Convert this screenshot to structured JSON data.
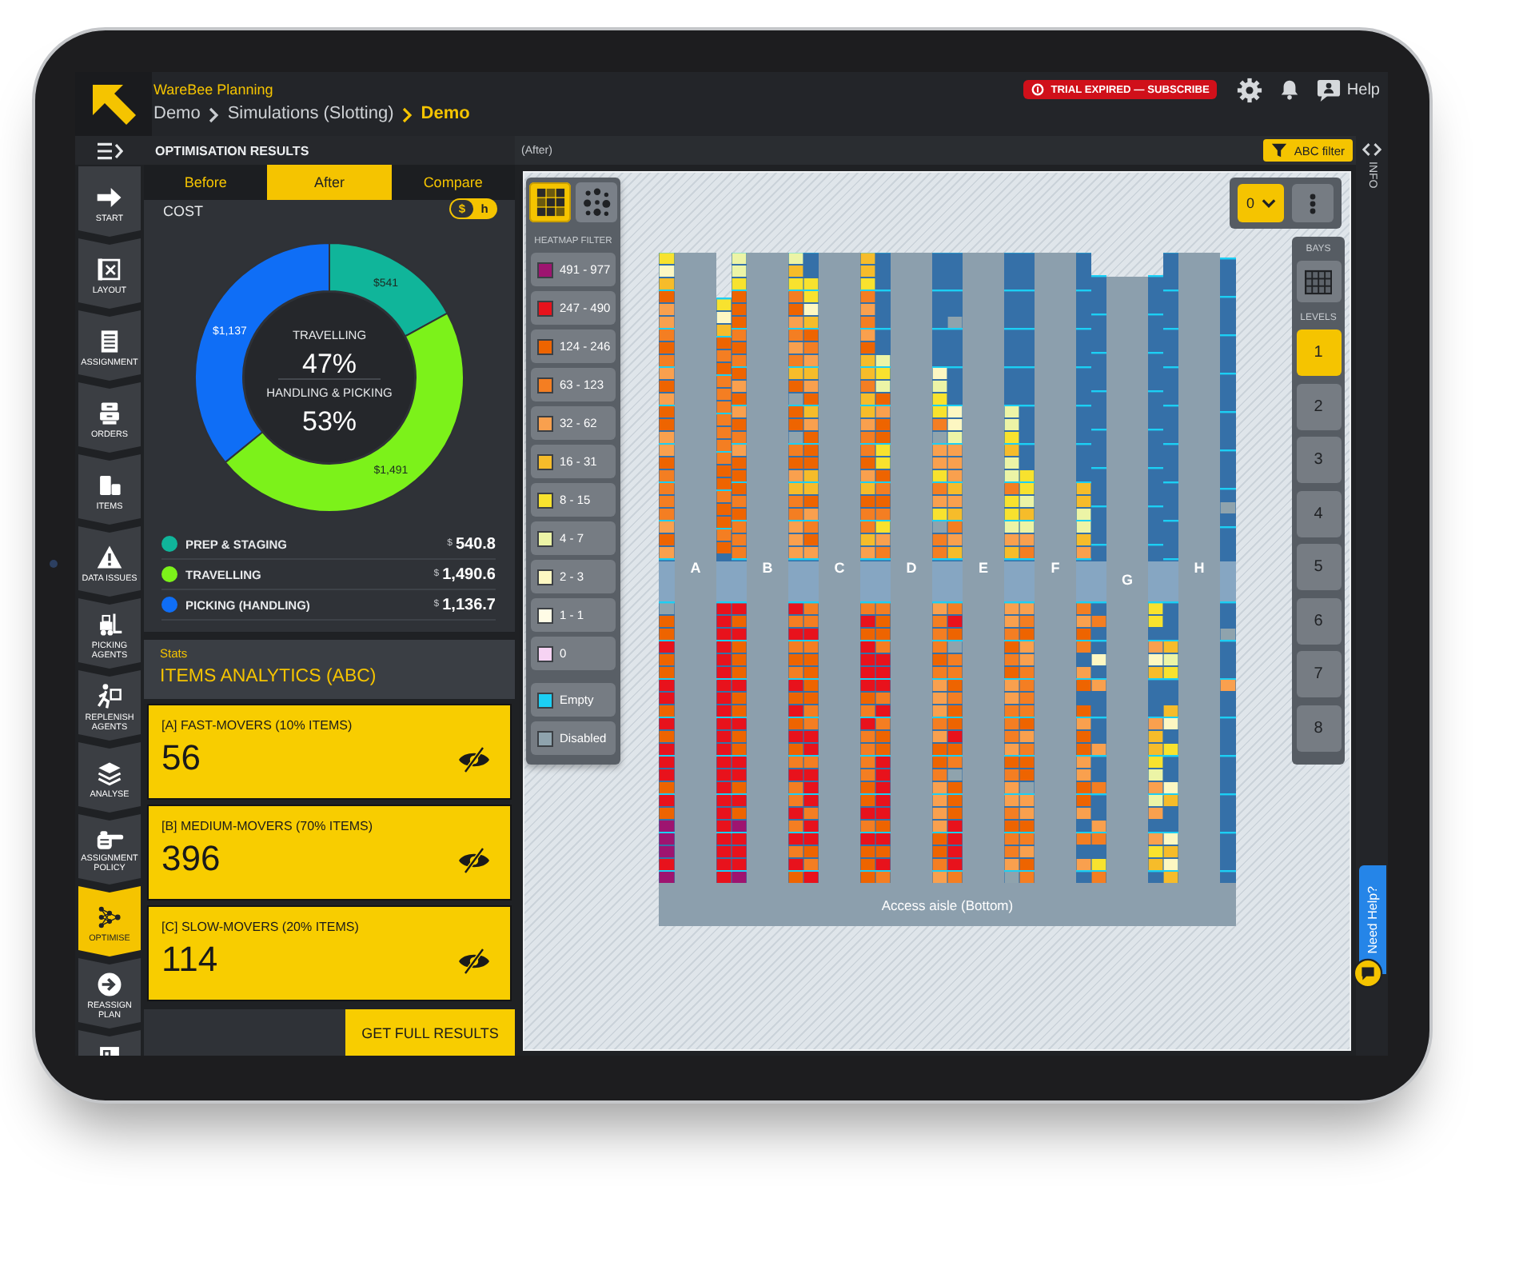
{
  "header": {
    "app_name": "WareBee Planning",
    "breadcrumb": [
      {
        "label": "Demo",
        "current": false
      },
      {
        "label": "Simulations (Slotting)",
        "current": false
      },
      {
        "label": "Demo",
        "current": true
      }
    ],
    "trial_badge": "TRIAL EXPIRED — SUBSCRIBE",
    "help": "Help"
  },
  "sidebar": {
    "items": [
      {
        "label": "START",
        "selected": false
      },
      {
        "label": "LAYOUT",
        "selected": false
      },
      {
        "label": "ASSIGNMENT",
        "selected": false
      },
      {
        "label": "ORDERS",
        "selected": false
      },
      {
        "label": "ITEMS",
        "selected": false
      },
      {
        "label": "DATA ISSUES",
        "selected": false
      },
      {
        "label": "PICKING AGENTS",
        "selected": false
      },
      {
        "label": "REPLENISH AGENTS",
        "selected": false
      },
      {
        "label": "ANALYSE",
        "selected": false
      },
      {
        "label": "ASSIGNMENT POLICY",
        "selected": false
      },
      {
        "label": "OPTIMISE",
        "selected": true
      },
      {
        "label": "REASSIGN PLAN",
        "selected": false
      },
      {
        "selected": false
      }
    ]
  },
  "results_panel": {
    "title": "OPTIMISATION RESULTS",
    "tabs": [
      {
        "label": "Before",
        "selected": false
      },
      {
        "label": "After",
        "selected": true
      },
      {
        "label": "Compare",
        "selected": false
      }
    ],
    "cost": {
      "title": "COST",
      "unit_toggle": [
        {
          "label": "$",
          "selected": true
        },
        {
          "label": "h",
          "selected": false
        }
      ],
      "chart_data": {
        "type": "donut",
        "categories": [
          "PREP & STAGING",
          "TRAVELLING",
          "PICKING (HANDLING)"
        ],
        "values": [
          540.8,
          1490.6,
          1136.7
        ],
        "value_labels": [
          "$541",
          "$1,491",
          "$1,137"
        ]
      },
      "center": [
        {
          "label": "TRAVELLING",
          "value": "47%"
        },
        {
          "label": "HANDLING & PICKING",
          "value": "53%"
        }
      ],
      "legend": [
        {
          "currency": "$",
          "amount": "540.8",
          "color": "#10b59a"
        },
        {
          "currency": "$",
          "amount": "1,490.6",
          "color": "#7cf21a"
        },
        {
          "currency": "$",
          "amount": "1,136.7",
          "color": "#0f6ef6"
        }
      ]
    }
  },
  "stats": {
    "kicker": "Stats",
    "title": "ITEMS ANALYTICS (ABC)",
    "cards": [
      {
        "label": "[A] FAST-MOVERS (10% ITEMS)",
        "value": "56"
      },
      {
        "label": "[B] MEDIUM-MOVERS (70% ITEMS)",
        "value": "396"
      },
      {
        "label": "[C] SLOW-MOVERS (20% ITEMS)",
        "value": "114"
      }
    ],
    "action": "GET FULL RESULTS"
  },
  "map_view": {
    "title": "(After)",
    "abc_filter": "ABC filter",
    "view_modes": [
      {
        "selected": true
      },
      {
        "selected": false
      }
    ],
    "heatmap_filter": {
      "title": "HEATMAP FILTER",
      "items": [
        {
          "label": "491 - 977",
          "color": "#9e1470"
        },
        {
          "label": "247 - 490",
          "color": "#e8121c"
        },
        {
          "label": "124 - 246",
          "color": "#ee6400"
        },
        {
          "label": "63 - 123",
          "color": "#f47e22"
        },
        {
          "label": "32 - 62",
          "color": "#f9a04e"
        },
        {
          "label": "16 - 31",
          "color": "#f6bc2a"
        },
        {
          "label": "8 - 15",
          "color": "#f8e22e"
        },
        {
          "label": "4 - 7",
          "color": "#ecf4a6"
        },
        {
          "label": "2 - 3",
          "color": "#fdf7c2"
        },
        {
          "label": "1 - 1",
          "color": "#fffce6"
        },
        {
          "label": "0",
          "color": "#f6d3f3"
        }
      ]
    },
    "location_filter": [
      {
        "label": "Empty",
        "color": "#1ccff4"
      },
      {
        "label": "Disabled",
        "color": "#8fa3ad"
      }
    ],
    "level_select": "0",
    "bays_label": "BAYS",
    "levels_label": "LEVELS",
    "levels": [
      {
        "label": "1",
        "selected": true
      },
      {
        "label": "2",
        "selected": false
      },
      {
        "label": "3",
        "selected": false
      },
      {
        "label": "4",
        "selected": false
      },
      {
        "label": "5",
        "selected": false
      },
      {
        "label": "6",
        "selected": false
      },
      {
        "label": "7",
        "selected": false
      },
      {
        "label": "8",
        "selected": false
      }
    ],
    "aisles": [
      {
        "label": "A"
      },
      {
        "label": "B"
      },
      {
        "label": "C"
      },
      {
        "label": "D"
      },
      {
        "label": "E"
      },
      {
        "label": "F"
      },
      {
        "label": "G"
      },
      {
        "label": "H"
      }
    ],
    "access_aisle": "Access aisle (Bottom)"
  },
  "info_panel": {
    "label": "INFO"
  },
  "help_tab": {
    "label": "Need Help?"
  }
}
